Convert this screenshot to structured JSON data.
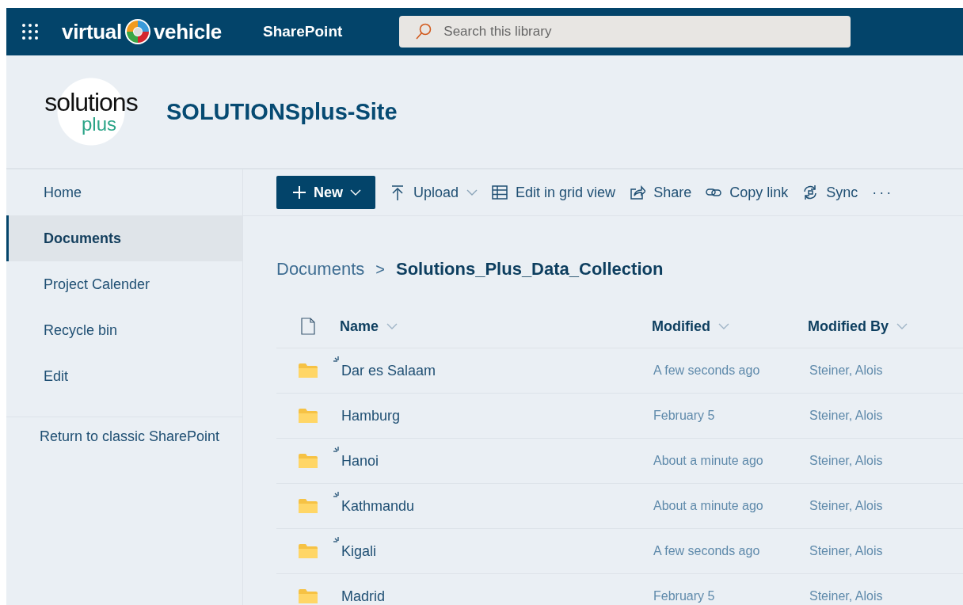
{
  "top_bar": {
    "brand_left": "virtual",
    "brand_right": "vehicle",
    "app_name": "SharePoint",
    "search": {
      "placeholder": "Search this library"
    }
  },
  "site": {
    "logo_top": "solutions",
    "logo_bottom": "plus",
    "title": "SOLUTIONSplus-Site"
  },
  "sidebar": {
    "items": [
      {
        "label": "Home",
        "selected": false
      },
      {
        "label": "Documents",
        "selected": true
      },
      {
        "label": "Project Calender",
        "selected": false
      },
      {
        "label": "Recycle bin",
        "selected": false
      },
      {
        "label": "Edit",
        "selected": false
      }
    ],
    "footer_link": "Return to classic SharePoint"
  },
  "toolbar": {
    "items": [
      {
        "kind": "new",
        "label": "New"
      },
      {
        "kind": "upload",
        "label": "Upload"
      },
      {
        "kind": "grid",
        "label": "Edit in grid view"
      },
      {
        "kind": "share",
        "label": "Share"
      },
      {
        "kind": "link",
        "label": "Copy link"
      },
      {
        "kind": "sync",
        "label": "Sync"
      },
      {
        "kind": "more",
        "label": "···"
      }
    ]
  },
  "breadcrumb": {
    "parent": "Documents",
    "separator": ">",
    "current": "Solutions_Plus_Data_Collection"
  },
  "table": {
    "columns": [
      "Name",
      "Modified",
      "Modified By"
    ],
    "rows": [
      {
        "name": "Dar es Salaam",
        "is_new": true,
        "modified": "A few seconds ago",
        "modified_by": "Steiner, Alois"
      },
      {
        "name": "Hamburg",
        "is_new": false,
        "modified": "February 5",
        "modified_by": "Steiner, Alois"
      },
      {
        "name": "Hanoi",
        "is_new": true,
        "modified": "About a minute ago",
        "modified_by": "Steiner, Alois"
      },
      {
        "name": "Kathmandu",
        "is_new": true,
        "modified": "About a minute ago",
        "modified_by": "Steiner, Alois"
      },
      {
        "name": "Kigali",
        "is_new": true,
        "modified": "A few seconds ago",
        "modified_by": "Steiner, Alois"
      },
      {
        "name": "Madrid",
        "is_new": false,
        "modified": "February 5",
        "modified_by": "Steiner, Alois"
      }
    ]
  }
}
